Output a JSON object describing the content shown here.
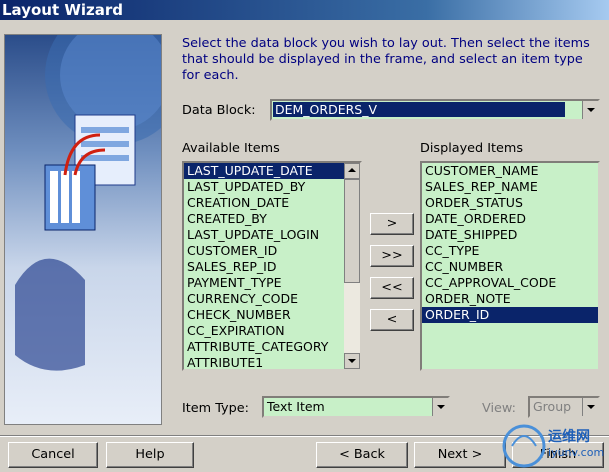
{
  "window": {
    "title": "Layout Wizard"
  },
  "instructions": "Select the data block you wish to lay out. Then select the items that should be displayed in the frame, and select an item type for each.",
  "data_block": {
    "label": "Data Block:",
    "value": "DEM_ORDERS_V"
  },
  "available": {
    "label": "Available Items",
    "items": [
      "LAST_UPDATE_DATE",
      "LAST_UPDATED_BY",
      "CREATION_DATE",
      "CREATED_BY",
      "LAST_UPDATE_LOGIN",
      "CUSTOMER_ID",
      "SALES_REP_ID",
      "PAYMENT_TYPE",
      "CURRENCY_CODE",
      "CHECK_NUMBER",
      "CC_EXPIRATION",
      "ATTRIBUTE_CATEGORY",
      "ATTRIBUTE1"
    ],
    "selected_index": 0
  },
  "displayed": {
    "label": "Displayed Items",
    "items": [
      "CUSTOMER_NAME",
      "SALES_REP_NAME",
      "ORDER_STATUS",
      "DATE_ORDERED",
      "DATE_SHIPPED",
      "CC_TYPE",
      "CC_NUMBER",
      "CC_APPROVAL_CODE",
      "ORDER_NOTE",
      "ORDER_ID"
    ],
    "selected_index": 9
  },
  "move": {
    "add_one": ">",
    "add_all": ">>",
    "remove_all": "<<",
    "remove_one": "<"
  },
  "item_type": {
    "label": "Item Type:",
    "value": "Text Item"
  },
  "view": {
    "label": "View:",
    "value": "Group"
  },
  "buttons": {
    "cancel": "Cancel",
    "help": "Help",
    "back": "< Back",
    "next": "Next >",
    "finish": "Finish"
  },
  "watermark": {
    "text": "运维网",
    "subtext": "iyunv.com"
  }
}
